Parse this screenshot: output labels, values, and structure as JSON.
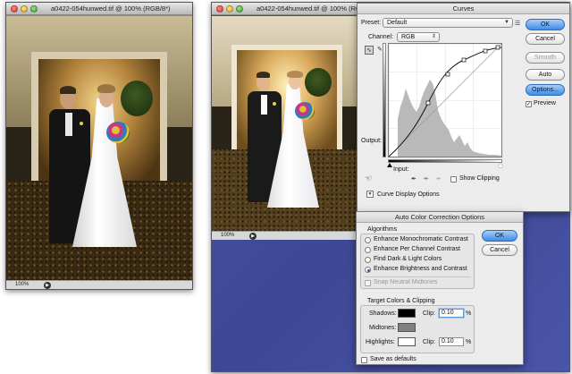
{
  "doc_left": {
    "title": "a0422-054hunwed.tif @ 100% (RGB/8*)",
    "zoom": "100%"
  },
  "doc_right": {
    "title": "a0422-054hunwed.tif @ 100% (RGB/8*)",
    "zoom": "100%"
  },
  "curves": {
    "title": "Curves",
    "preset_label": "Preset:",
    "preset_value": "Default",
    "channel_label": "Channel:",
    "channel_value": "RGB",
    "output_label": "Output:",
    "input_label": "Input:",
    "show_clipping_label": "Show Clipping",
    "show_clipping_checked": false,
    "curve_display_options_label": "Curve Display Options",
    "buttons": {
      "ok": "OK",
      "cancel": "Cancel",
      "smooth": "Smooth",
      "auto": "Auto",
      "options": "Options..."
    },
    "preview_label": "Preview",
    "preview_checked": true
  },
  "auto_color": {
    "title": "Auto Color Correction Options",
    "algorithms_label": "Algorithms",
    "algorithms": [
      {
        "label": "Enhance Monochromatic Contrast",
        "selected": false
      },
      {
        "label": "Enhance Per Channel Contrast",
        "selected": false
      },
      {
        "label": "Find Dark & Light Colors",
        "selected": false
      },
      {
        "label": "Enhance Brightness and Contrast",
        "selected": true
      }
    ],
    "snap_label": "Snap Neutral Midtones",
    "snap_checked": false,
    "target_label": "Target Colors & Clipping",
    "shadows_label": "Shadows:",
    "shadows_color": "#000000",
    "shadows_clip_label": "Clip:",
    "shadows_clip_value": "0.10",
    "midtones_label": "Midtones:",
    "midtones_color": "#808080",
    "highlights_label": "Highlights:",
    "highlights_color": "#ffffff",
    "highlights_clip_label": "Clip:",
    "highlights_clip_value": "0.10",
    "percent": "%",
    "save_defaults_label": "Save as defaults",
    "save_defaults_checked": false,
    "buttons": {
      "ok": "OK",
      "cancel": "Cancel"
    }
  },
  "colors": {
    "canvas_blue": "#4149a0",
    "default_button": "#3f8de6"
  }
}
